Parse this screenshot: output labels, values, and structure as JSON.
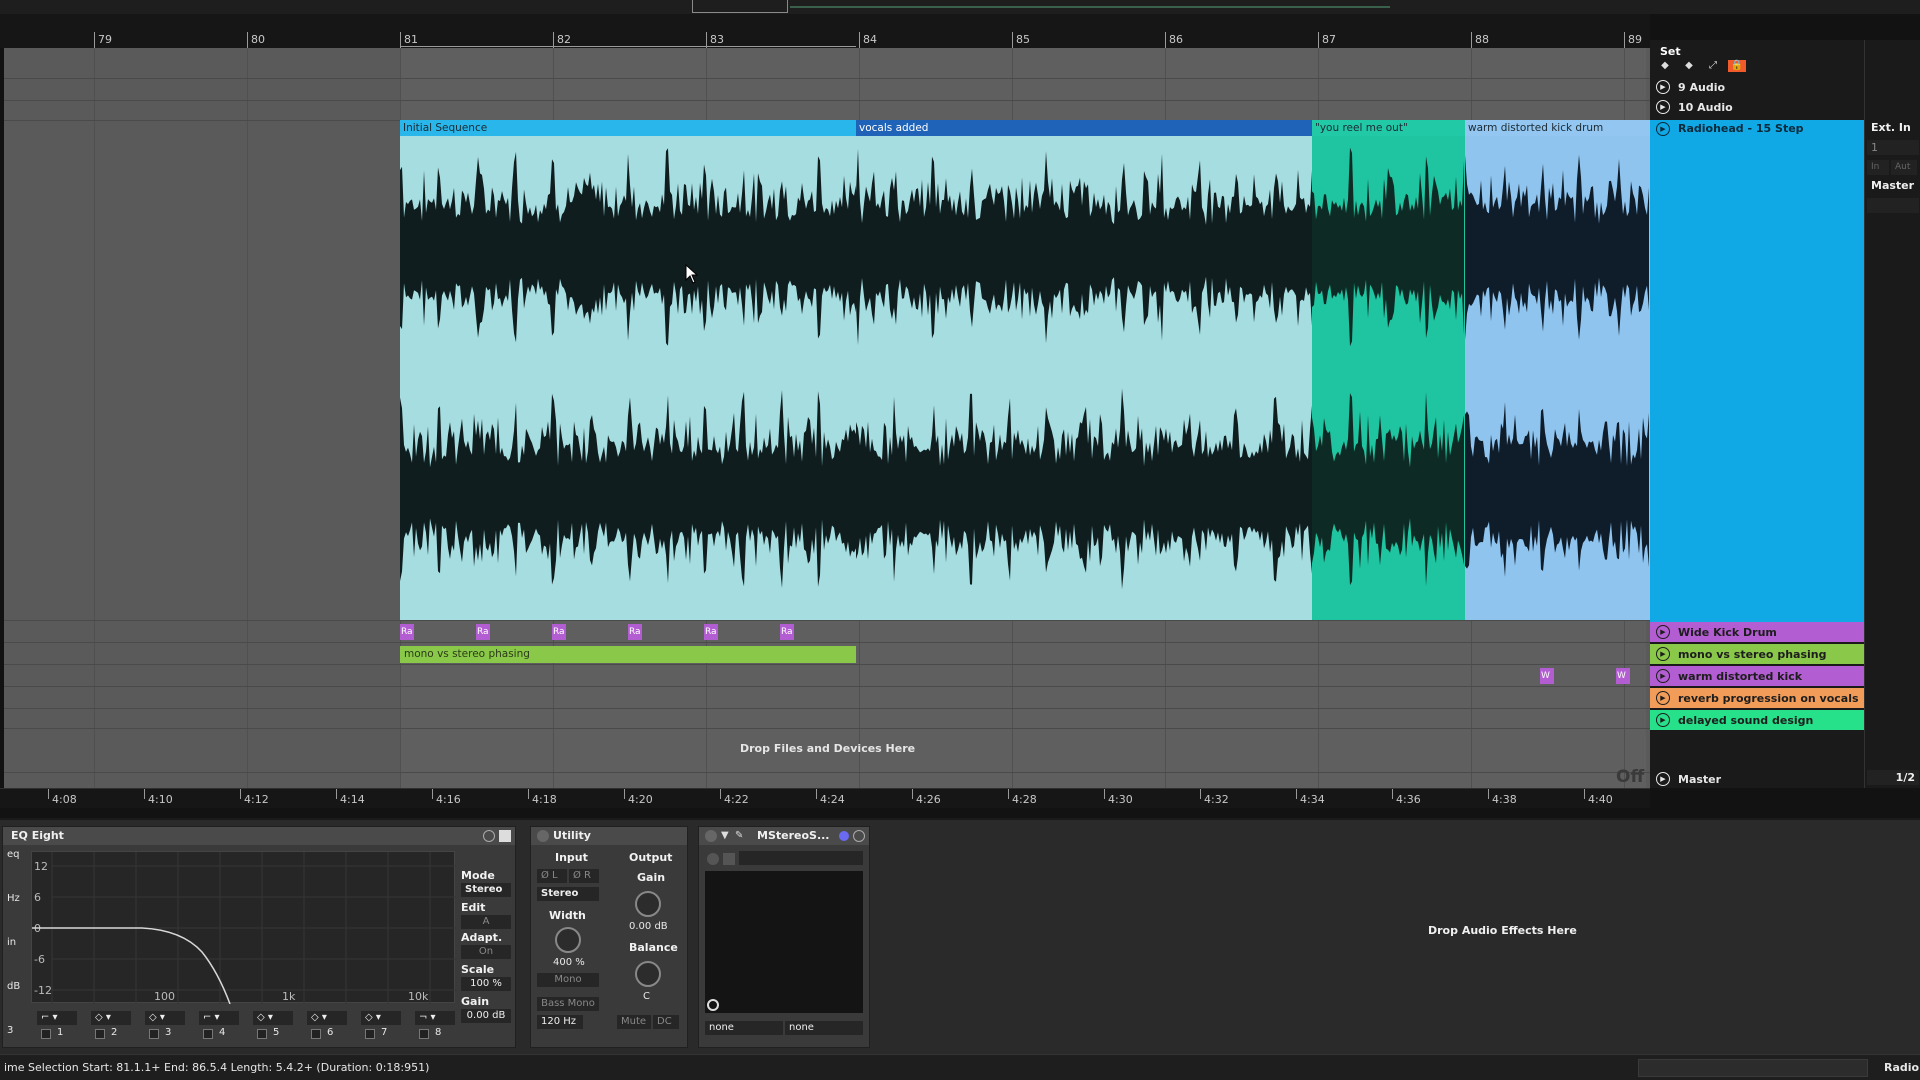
{
  "ruler": {
    "bars": [
      "79",
      "80",
      "81",
      "82",
      "83",
      "84",
      "85",
      "86",
      "87",
      "88",
      "89"
    ]
  },
  "set": {
    "label": "Set"
  },
  "clips": [
    {
      "name": "Initial Sequence",
      "color": "#a6dde0",
      "header": "#29b6ea"
    },
    {
      "name": "vocals added",
      "color": "#a6dde0",
      "header": "#1f63b8"
    },
    {
      "name": "\"you reel me out\"",
      "color": "#1fc4a1",
      "header": "#22c9a7"
    },
    {
      "name": "warm distorted kick drum",
      "color": "#8fc4ee",
      "header": "#93c6f0"
    }
  ],
  "tracks": [
    {
      "name": "9 Audio",
      "color": "#1a1a1a"
    },
    {
      "name": "10 Audio",
      "color": "#1a1a1a"
    },
    {
      "name": "Radiohead - 15 Step",
      "color": "#11a8e6"
    },
    {
      "name": "Wide Kick Drum",
      "color": "#b25dd1"
    },
    {
      "name": "mono vs stereo phasing",
      "color": "#8ac849"
    },
    {
      "name": "warm distorted kick",
      "color": "#b25dd1"
    },
    {
      "name": "reverb progression on vocals",
      "color": "#f19d59"
    },
    {
      "name": "delayed sound design",
      "color": "#27e08a"
    },
    {
      "name": "Master",
      "color": "#1a1a1a"
    }
  ],
  "io": {
    "input": "Ext. In",
    "channel": "1",
    "in_auto_in": "In",
    "in_auto_auto": "Aut",
    "output": "Master",
    "master_ratio": "1/2"
  },
  "lanes": {
    "wide_kick_clip_label": "Ra",
    "warm_kick_clip_label": "W",
    "green_clip": "mono vs stereo phasing",
    "drop_files": "Drop Files and Devices Here",
    "off": "Off"
  },
  "time_ruler": [
    "4:08",
    "4:10",
    "4:12",
    "4:14",
    "4:16",
    "4:18",
    "4:20",
    "4:22",
    "4:24",
    "4:26",
    "4:28",
    "4:30",
    "4:32",
    "4:34",
    "4:36",
    "4:38",
    "4:40"
  ],
  "eq": {
    "title": "EQ Eight",
    "db_labels": [
      "12",
      "6",
      "0",
      "-6",
      "-12"
    ],
    "freq_labels": [
      "100",
      "1k",
      "10k"
    ],
    "mode_label": "Mode",
    "mode_value": "Stereo",
    "edit_label": "Edit",
    "edit_value": "A",
    "adapt_label": "Adapt. Q",
    "adapt_value": "On",
    "scale_label": "Scale",
    "scale_value": "100 %",
    "gain_label": "Gain",
    "gain_value": "0.00 dB",
    "bands": [
      "1",
      "2",
      "3",
      "4",
      "5",
      "6",
      "7",
      "8"
    ],
    "side_labels": [
      "eq",
      "Hz",
      "in",
      "dB",
      "3"
    ]
  },
  "utility": {
    "title": "Utility",
    "input_label": "Input",
    "output_label": "Output",
    "phase_l": "Ø L",
    "phase_r": "Ø R",
    "channel_mode": "Stereo",
    "width_label": "Width",
    "width_value": "400 %",
    "mono": "Mono",
    "bass_mono": "Bass Mono",
    "bass_freq": "120 Hz",
    "gain_label": "Gain",
    "gain_value": "0.00 dB",
    "balance_label": "Balance",
    "balance_value": "C",
    "mute": "Mute",
    "dc": "DC"
  },
  "mstereo": {
    "title": "MStereoS...",
    "sel1": "none",
    "sel2": "none"
  },
  "drop_fx": "Drop Audio Effects Here",
  "status": {
    "text": "ime Selection   Start: 81.1.1+   End: 86.5.4   Length: 5.4.2+ (Duration: 0:18:951)",
    "right": "Radio"
  }
}
